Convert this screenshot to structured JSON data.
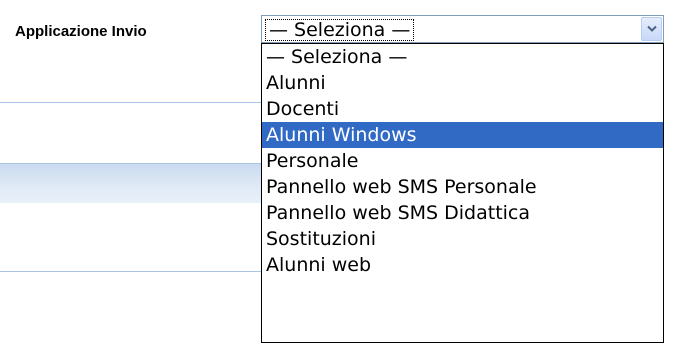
{
  "form": {
    "label": "Applicazione Invio"
  },
  "select": {
    "value": "— Seleziona —",
    "arrow_icon": "chevron-down-icon",
    "options": [
      "— Seleziona —",
      "Alunni",
      "Docenti",
      "Alunni Windows",
      "Personale",
      "Pannello web SMS Personale",
      "Pannello web SMS Didattica",
      "Sostituzioni",
      "Alunni web"
    ],
    "highlighted_option": "Alunni Windows"
  },
  "colors": {
    "highlight": "#316ac5",
    "highlight_text": "#ffffff",
    "rule": "#a9c3e3",
    "band": "#dfe9f6"
  }
}
